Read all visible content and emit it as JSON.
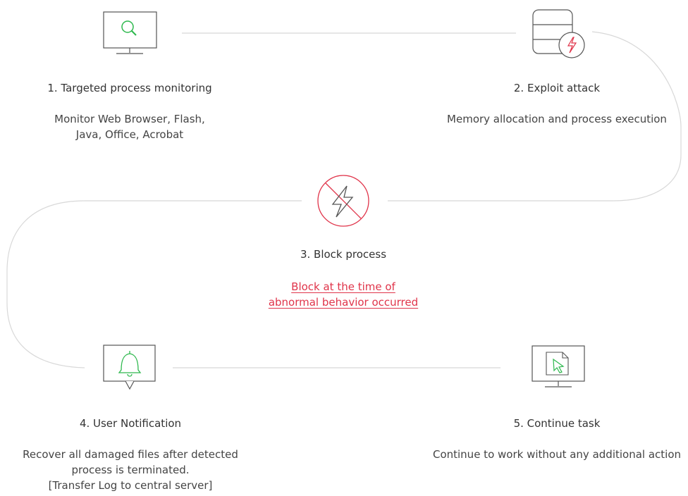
{
  "colors": {
    "line": "#d8d8d8",
    "icon_green": "#2db84d",
    "accent_red": "#e0344a",
    "icon_grey": "#555555"
  },
  "steps": [
    {
      "title": "1. Targeted process monitoring",
      "desc": [
        "Monitor Web Browser, Flash,",
        "Java, Office, Acrobat"
      ],
      "icon": "search-monitor-icon"
    },
    {
      "title": "2. Exploit attack",
      "desc": [
        "Memory allocation and process execution"
      ],
      "icon": "database-lightning-icon"
    },
    {
      "title": "3. Block process",
      "desc": [
        "Block at the time of ",
        "abnormal behavior occurred"
      ],
      "icon": "blocked-lightning-icon"
    },
    {
      "title": "4. User Notification",
      "desc": [
        "Recover all damaged files after detected",
        "process is terminated.",
        "[Transfer Log to central server]"
      ],
      "icon": "bell-notification-icon"
    },
    {
      "title": "5. Continue task",
      "desc": [
        "Continue to work without any additional action"
      ],
      "icon": "cursor-document-icon"
    }
  ]
}
